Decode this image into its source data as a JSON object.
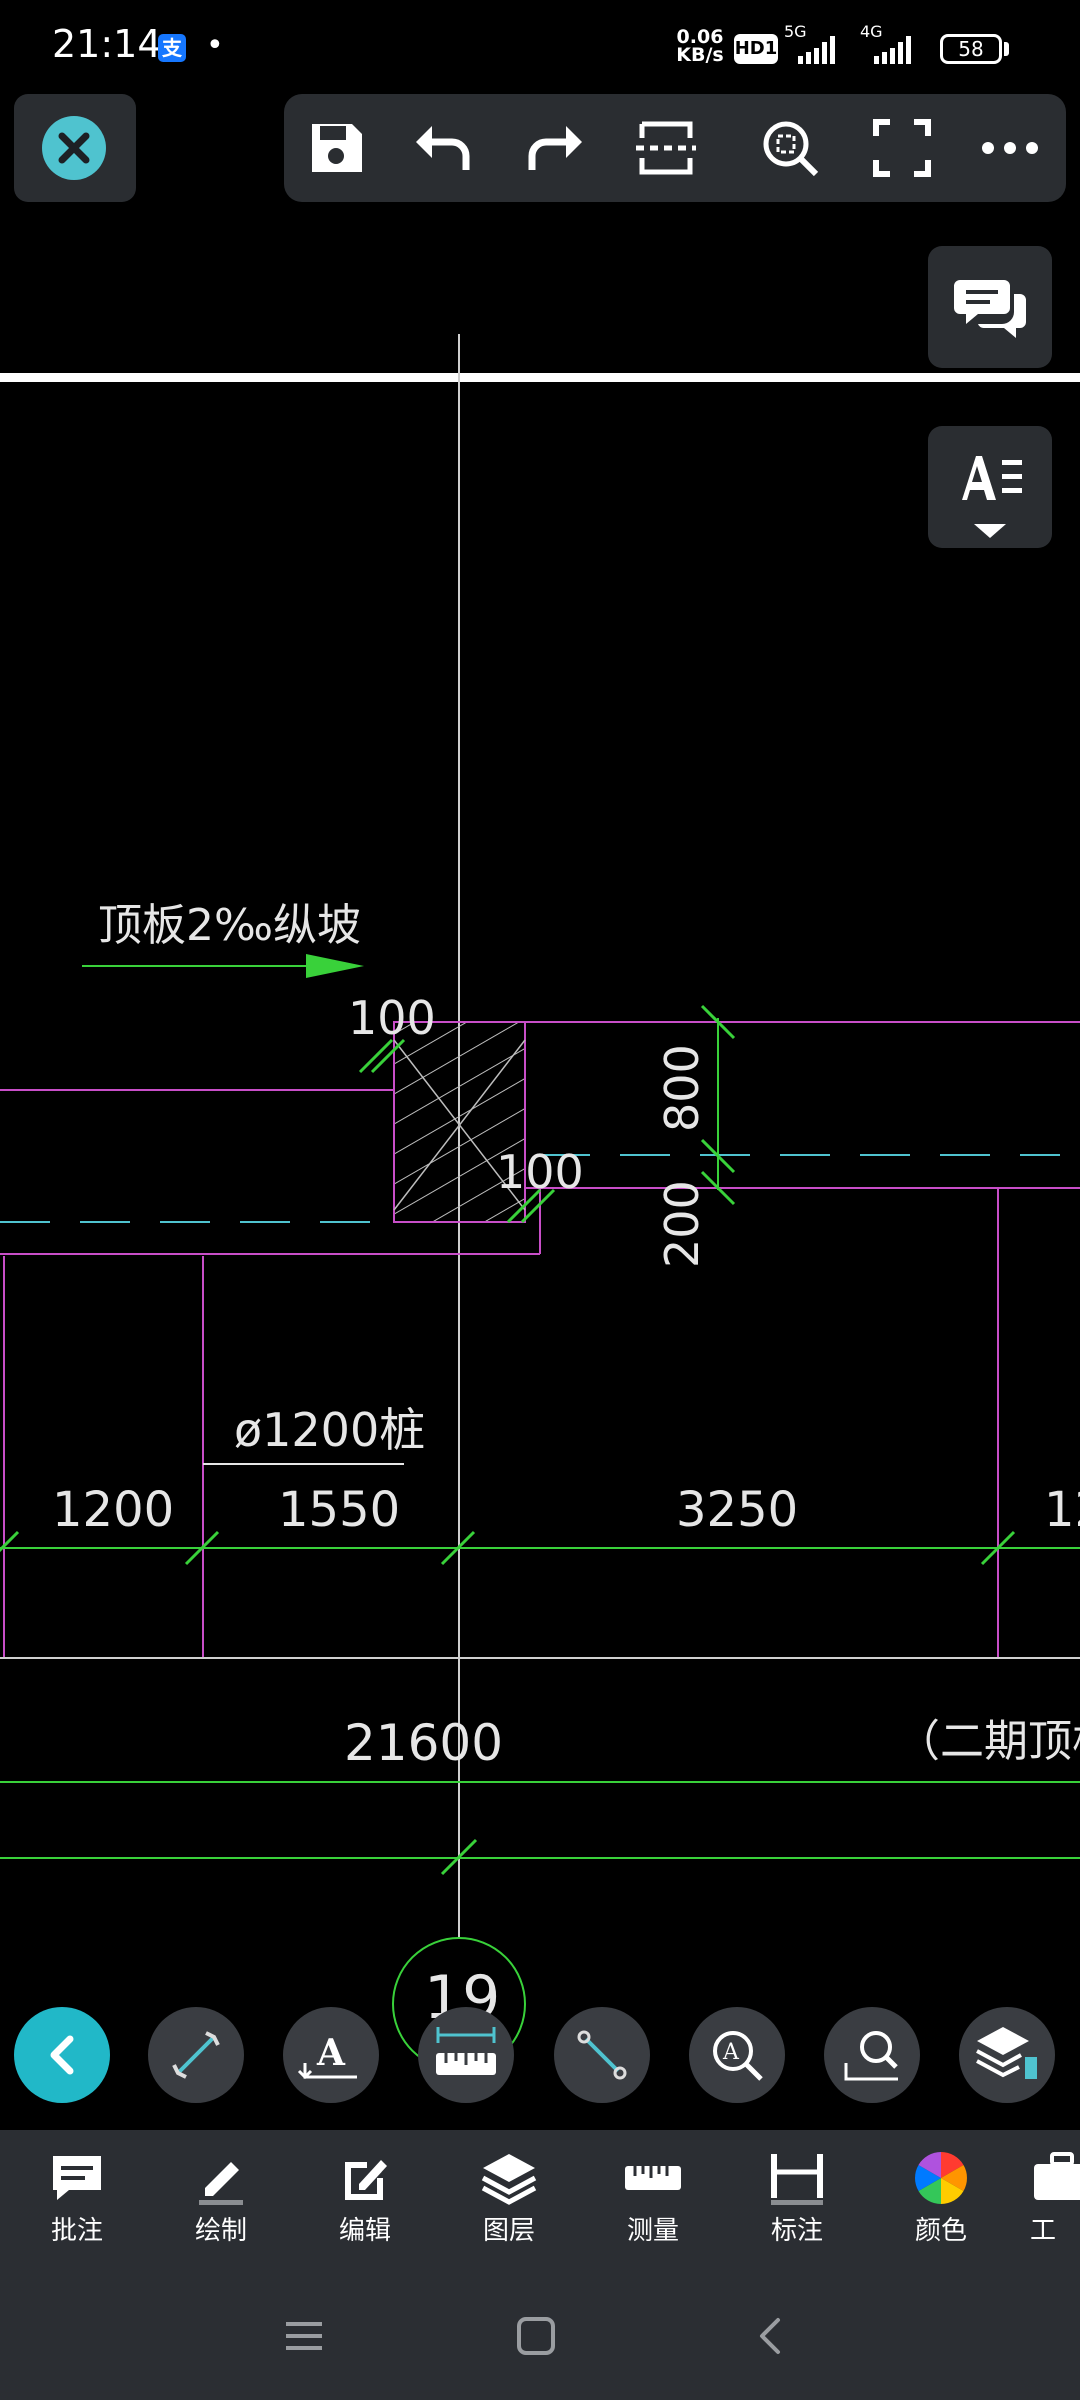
{
  "status_bar": {
    "time": "21:14",
    "app_icon_text": "支",
    "net_speed_value": "0.06",
    "net_speed_unit": "KB/s",
    "hd_badge": "HD1",
    "signal_1_label": "5G",
    "signal_2_label": "4G",
    "battery": "58"
  },
  "drawing": {
    "slope_label": "顶板2‰纵坡",
    "dim_100_top": "100",
    "dim_100_mid": "100",
    "dim_800": "800",
    "dim_200": "200",
    "pile_label": "ø1200桩",
    "dim_1200": "1200",
    "dim_1550": "1550",
    "dim_3250": "3250",
    "dim_12": "12",
    "dim_21600": "21600",
    "phase2_label": "（二期顶板纟",
    "axis_bubble": "19"
  },
  "bottom_bar": {
    "items": [
      {
        "label": "批注"
      },
      {
        "label": "绘制"
      },
      {
        "label": "编辑"
      },
      {
        "label": "图层"
      },
      {
        "label": "测量"
      },
      {
        "label": "标注"
      },
      {
        "label": "颜色"
      },
      {
        "label": "工"
      }
    ]
  },
  "colors": {
    "accent": "#21b8c8",
    "cad_magenta": "#c84ec8",
    "cad_green": "#39d13a",
    "panel_bg": "#2a2d31"
  }
}
